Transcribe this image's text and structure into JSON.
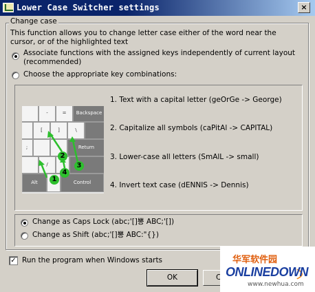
{
  "window": {
    "title": "Lower Case Switcher settings",
    "close_glyph": "×"
  },
  "group": {
    "label": "Change case",
    "description": "This function allows you to change letter case either of the word near the cursor, or of the highlighted text"
  },
  "options": {
    "associate_label": "Associate functions with the assigned keys independently of current layout (recommended)",
    "choose_label": "Choose the appropriate key combinations:",
    "selected": "associate"
  },
  "keyboard": {
    "keys": [
      "-",
      "=",
      "Backspace",
      "[",
      "]",
      "\\",
      ";",
      "'",
      "Return",
      "/",
      "Alt",
      "Control"
    ],
    "markers": [
      "1",
      "2",
      "3",
      "4"
    ]
  },
  "functions": [
    "1. Text with a capital letter (geOrGe -> George)",
    "2. Capitalize all symbols (caPitAl -> CAPITAL)",
    "3. Lower-case all letters  (SmAlL -> small)",
    "4. Invert text case (dENNIS -> Dennis)"
  ],
  "switch_options": {
    "caps_label": "Change as Caps Lock (abc;'[]뽕 ABC;'[])",
    "shift_label": "Change as Shift (abc;'[]뽕 ABC:\"{})",
    "selected": "caps"
  },
  "startup": {
    "label": "Run the program when Windows starts",
    "checked": true,
    "check_glyph": "✓"
  },
  "buttons": {
    "ok": "OK",
    "cancel_partial": "C"
  },
  "watermark": {
    "cn": "华军软件园",
    "brand": "ONLINEDOWN",
    "url": "www.newhua.com"
  },
  "colors": {
    "titlebar": "#0a246a",
    "face": "#d4d0c8",
    "marker": "#2dbf2d"
  }
}
